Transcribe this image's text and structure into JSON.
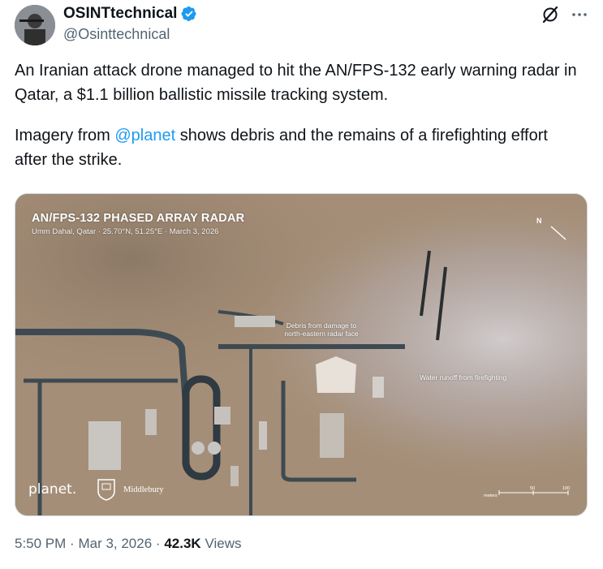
{
  "author": {
    "display_name": "OSINTtechnical",
    "handle": "@Osinttechnical",
    "verified": true
  },
  "header_icons": {
    "grok": "grok-icon",
    "more": "more-icon"
  },
  "tweet": {
    "paragraph1": "An Iranian attack drone managed to hit the AN/FPS-132 early warning radar in Qatar, a $1.1 billion ballistic missile tracking system.",
    "paragraph2_before": "Imagery from ",
    "mention": "@planet",
    "paragraph2_after": " shows debris and the remains of a firefighting effort after the strike."
  },
  "media": {
    "title": "AN/FPS-132 PHASED ARRAY RADAR",
    "subtitle": "Umm Dahal, Qatar · 25.70°N, 51.25°E · March 3, 2026",
    "north_label": "N",
    "annotation_debris": "Debris from damage to north-eastern radar face",
    "annotation_water": "Water runoff from firefighting",
    "planet_logo": "planet.",
    "partner": "Middlebury",
    "scale_unit": "meters",
    "scale_mid": "50",
    "scale_end": "100"
  },
  "meta": {
    "time": "5:50 PM",
    "separator": "·",
    "date": "Mar 3, 2026",
    "views_count": "42.3K",
    "views_label": "Views"
  },
  "colors": {
    "link": "#1d9bf0",
    "verified": "#1d9bf0",
    "secondary_text": "#536471"
  }
}
